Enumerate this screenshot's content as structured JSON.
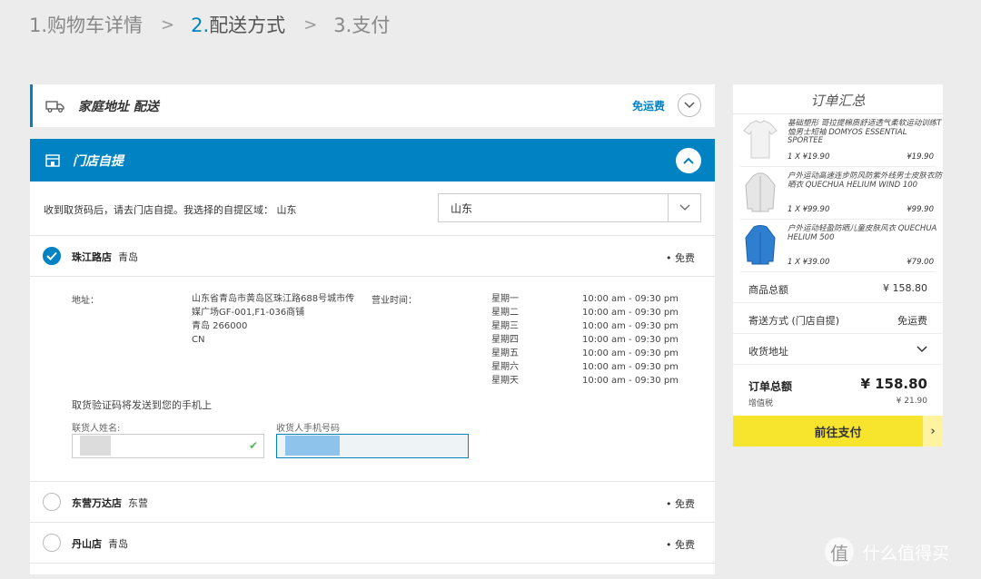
{
  "steps": [
    {
      "num": "1.",
      "label": "购物车详情"
    },
    {
      "num": "2.",
      "label": "配送方式"
    },
    {
      "num": "3.",
      "label": "支付"
    }
  ],
  "step_separator": ">",
  "home_delivery": {
    "title": "家庭地址 配送",
    "badge": "免运费",
    "icon": "truck-icon"
  },
  "store_pickup": {
    "title": "门店自提",
    "icon": "store-icon",
    "region_label": "收到取货码后，请去门店自提。我选择的自提区域： 山东",
    "region_value": "山东",
    "stores": [
      {
        "name": "珠江路店",
        "city": "青岛",
        "fee": "• 免费",
        "selected": true
      },
      {
        "name": "东营万达店",
        "city": "东营",
        "fee": "• 免费",
        "selected": false
      },
      {
        "name": "丹山店",
        "city": "青岛",
        "fee": "• 免费",
        "selected": false
      }
    ],
    "detail": {
      "address_label": "地址：",
      "address_lines": [
        "山东省青岛市黄岛区珠江路688号城市传",
        "媒广场GF-001,F1-036商铺",
        "青岛 266000",
        "CN"
      ],
      "hours_label": "营业时间：",
      "days": [
        "星期一",
        "星期二",
        "星期三",
        "星期四",
        "星期五",
        "星期六",
        "星期天"
      ],
      "times": [
        "10:00 am - 09:30 pm",
        "10:00 am - 09:30 pm",
        "10:00 am - 09:30 pm",
        "10:00 am - 09:30 pm",
        "10:00 am - 09:30 pm",
        "10:00 am - 09:30 pm",
        "10:00 am - 09:30 pm"
      ],
      "sms_note": "取货验证码将发送到您的手机上",
      "name_label": "联货人姓名:",
      "phone_label": "收货人手机号码"
    }
  },
  "summary": {
    "title": "订单汇总",
    "items": [
      {
        "desc": "基础塑形 哥拉提棉质舒适透气柔软运动训练T恤男士短袖 DOMYOS ESSENTIAL SPORTEE",
        "qty": "1 X ¥19.90",
        "price": "¥19.90",
        "color": "#f2f2f2"
      },
      {
        "desc": "户外运动高速连步防风防紫外线男士皮肤衣防晒衣 QUECHUA HELIUM WIND 100",
        "qty": "1 X ¥99.90",
        "price": "¥99.90",
        "color": "#e6e6e6"
      },
      {
        "desc": "户外运动轻盈防晒儿童皮肤风衣 QUECHUA HELIUM 500",
        "qty": "1 X ¥39.00",
        "price": "¥79.00",
        "color": "#2f7fd1"
      }
    ],
    "subtotal_label": "商品总额",
    "subtotal_value": "¥ 158.80",
    "shipping_label": "寄送方式 (门店自提)",
    "shipping_value": "免运费",
    "address_label": "收货地址",
    "total_label": "订单总额",
    "total_value": "¥ 158.80",
    "tax_label": "增值税",
    "tax_value": "¥ 21.90",
    "pay_label": "前往支付"
  },
  "watermark": "什么值得买",
  "colors": {
    "accent": "#0082c3",
    "pay_button": "#f7e42d",
    "background": "#ececec"
  }
}
